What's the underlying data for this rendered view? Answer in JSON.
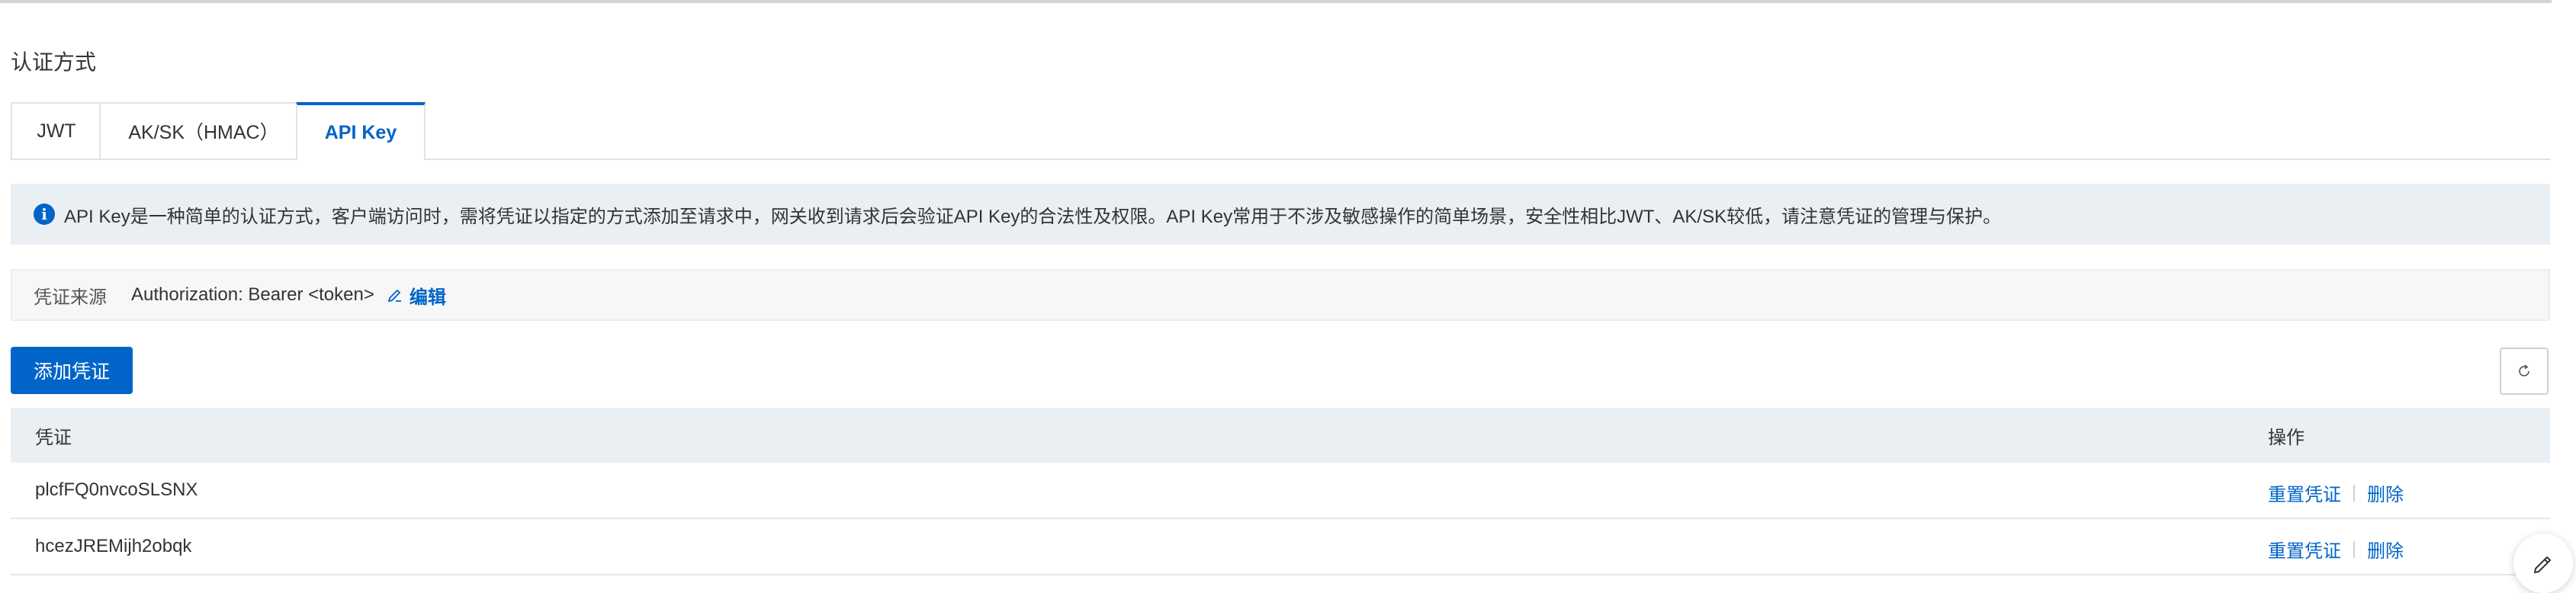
{
  "section_title": "认证方式",
  "tabs": [
    {
      "label": "JWT",
      "active": false
    },
    {
      "label": "AK/SK（HMAC）",
      "active": false
    },
    {
      "label": "API Key",
      "active": true
    }
  ],
  "info": {
    "icon": "info-icon",
    "text": "API Key是一种简单的认证方式，客户端访问时，需将凭证以指定的方式添加至请求中，网关收到请求后会验证API Key的合法性及权限。API Key常用于不涉及敏感操作的简单场景，安全性相比JWT、AK/SK较低，请注意凭证的管理与保护。"
  },
  "source": {
    "label": "凭证来源",
    "value": "Authorization: Bearer <token>",
    "edit_label": "编辑"
  },
  "toolbar": {
    "add_label": "添加凭证",
    "refresh_icon": "refresh-icon"
  },
  "table": {
    "headers": {
      "credential": "凭证",
      "actions": "操作"
    },
    "rows": [
      {
        "credential": "plcfFQ0nvcoSLSNX",
        "reset_label": "重置凭证",
        "delete_label": "删除"
      },
      {
        "credential": "hcezJREMijh2obqk",
        "reset_label": "重置凭证",
        "delete_label": "删除"
      }
    ]
  },
  "colors": {
    "accent": "#0064c8",
    "banner_bg": "#eaeff4"
  }
}
